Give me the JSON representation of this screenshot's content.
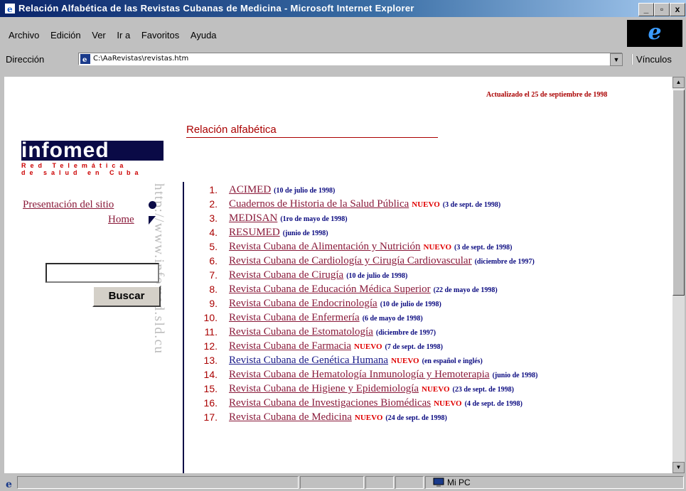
{
  "window": {
    "title": "Relación Alfabética de las Revistas Cubanas de Medicina - Microsoft Internet Explorer",
    "buttons": [
      "_",
      "▫",
      "x"
    ]
  },
  "menu": [
    "Archivo",
    "Edición",
    "Ver",
    "Ir a",
    "Favoritos",
    "Ayuda"
  ],
  "address": {
    "label": "Dirección",
    "url": "C:\\AaRevistas\\revistas.htm",
    "links_label": "Vínculos"
  },
  "page": {
    "updated": "Actualizado el 25 de septiembre de 1998",
    "heading": "Relación alfabética",
    "logo": {
      "name": "infomed",
      "line1": "Red Telemática",
      "line2": "de salud en Cuba"
    },
    "side_url": "http://www.infomed.sld.cu",
    "nav": {
      "presentation": "Presentación del sitio",
      "home": "Home"
    },
    "search": {
      "button": "Buscar",
      "value": ""
    },
    "journals": [
      {
        "num": "1.",
        "title": "ACIMED",
        "nuevo": "",
        "date": "(10 de julio de 1998)"
      },
      {
        "num": "2.",
        "title": "Cuadernos de Historia de la Salud Pública",
        "nuevo": "NUEVO",
        "date": "(3 de sept. de 1998)"
      },
      {
        "num": "3.",
        "title": "MEDISAN",
        "nuevo": "",
        "date": "(1ro de mayo de 1998)"
      },
      {
        "num": "4.",
        "title": "RESUMED",
        "nuevo": "",
        "date": "(junio de 1998)"
      },
      {
        "num": "5.",
        "title": "Revista Cubana de Alimentación y Nutrición",
        "nuevo": "NUEVO",
        "date": "(3 de sept. de 1998)"
      },
      {
        "num": "6.",
        "title": "Revista Cubana de Cardiología y Cirugía Cardiovascular",
        "nuevo": "",
        "date": "(diciembre de 1997)"
      },
      {
        "num": "7.",
        "title": "Revista Cubana de Cirugía",
        "nuevo": "",
        "date": "(10 de julio de 1998)"
      },
      {
        "num": "8.",
        "title": "Revista Cubana de Educación Médica Superior",
        "nuevo": "",
        "date": "(22 de mayo de 1998)"
      },
      {
        "num": "9.",
        "title": "Revista Cubana de Endocrinología",
        "nuevo": "",
        "date": "(10 de julio de 1998)"
      },
      {
        "num": "10.",
        "title": "Revista Cubana de Enfermería",
        "nuevo": "",
        "date": "(6 de mayo de 1998)"
      },
      {
        "num": "11.",
        "title": "Revista Cubana de Estomatología",
        "nuevo": "",
        "date": "(diciembre de 1997)"
      },
      {
        "num": "12.",
        "title": "Revista Cubana de Farmacia",
        "nuevo": "NUEVO",
        "date": "(7 de sept. de 1998)"
      },
      {
        "num": "13.",
        "title": "Revista Cubana de Genética Humana",
        "nuevo": "NUEVO",
        "date": "(en español e inglés)"
      },
      {
        "num": "14.",
        "title": "Revista Cubana de Hematología Inmunología y Hemoterapia",
        "nuevo": "",
        "date": "(junio de 1998)"
      },
      {
        "num": "15.",
        "title": "Revista Cubana de Higiene y Epidemiología",
        "nuevo": "NUEVO",
        "date": "(23 de sept. de 1998)"
      },
      {
        "num": "16.",
        "title": "Revista Cubana de Investigaciones Biomédicas",
        "nuevo": "NUEVO",
        "date": "(4 de sept. de 1998)"
      },
      {
        "num": "17.",
        "title": "Revista Cubana de Medicina",
        "nuevo": "NUEVO",
        "date": "(24 de sept. de 1998)"
      }
    ]
  },
  "status": {
    "zone": "Mi PC"
  }
}
